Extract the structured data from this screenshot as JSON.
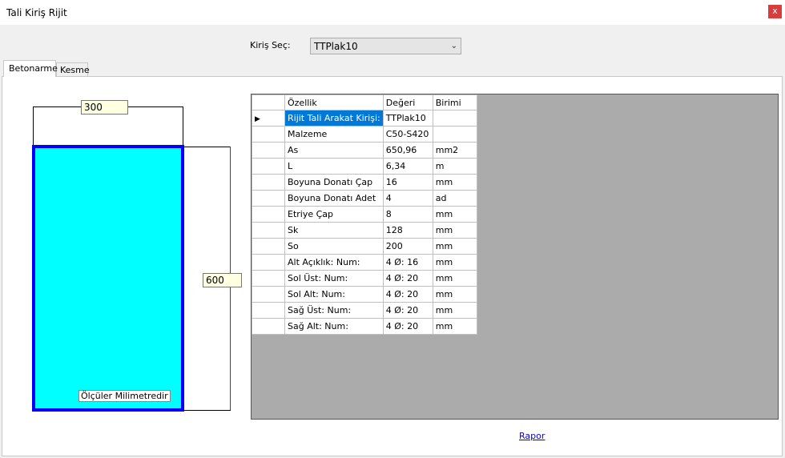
{
  "window": {
    "title": "Tali Kiriş Rijit",
    "close_label": "x"
  },
  "selector": {
    "label": "Kiriş Seç:",
    "value": "TTPlak10"
  },
  "tabs": [
    "Betonarme",
    "Kesme"
  ],
  "drawing": {
    "width_value": "300",
    "height_value": "600",
    "note": "Ölçüler Milimetredir",
    "fill_color": "#00ffff",
    "border_color": "#0000ff",
    "dim_color": "#e00000"
  },
  "table": {
    "headers": [
      "Özellik",
      "Değeri",
      "Birimi"
    ],
    "rows": [
      [
        "Rijit Tali Arakat Kirişi:",
        "TTPlak10",
        ""
      ],
      [
        "Malzeme",
        "C50-S420",
        ""
      ],
      [
        "As",
        "650,96",
        "mm2"
      ],
      [
        "L",
        "6,34",
        "m"
      ],
      [
        "Boyuna Donatı Çap",
        "16",
        "mm"
      ],
      [
        "Boyuna Donatı Adet",
        "4",
        "ad"
      ],
      [
        "Etriye Çap",
        "8",
        "mm"
      ],
      [
        "Sk",
        "128",
        "mm"
      ],
      [
        "So",
        "200",
        "mm"
      ],
      [
        "Alt Açıklık: Num:",
        "4 Ø: 16",
        "mm"
      ],
      [
        "Sol Üst: Num:",
        "4 Ø: 20",
        "mm"
      ],
      [
        "Sol Alt: Num:",
        "4 Ø: 20",
        "mm"
      ],
      [
        "Sağ Üst: Num:",
        "4 Ø: 20",
        "mm"
      ],
      [
        "Sağ Alt: Num:",
        "4 Ø: 20",
        "mm"
      ]
    ]
  },
  "report_link": "Rapor"
}
